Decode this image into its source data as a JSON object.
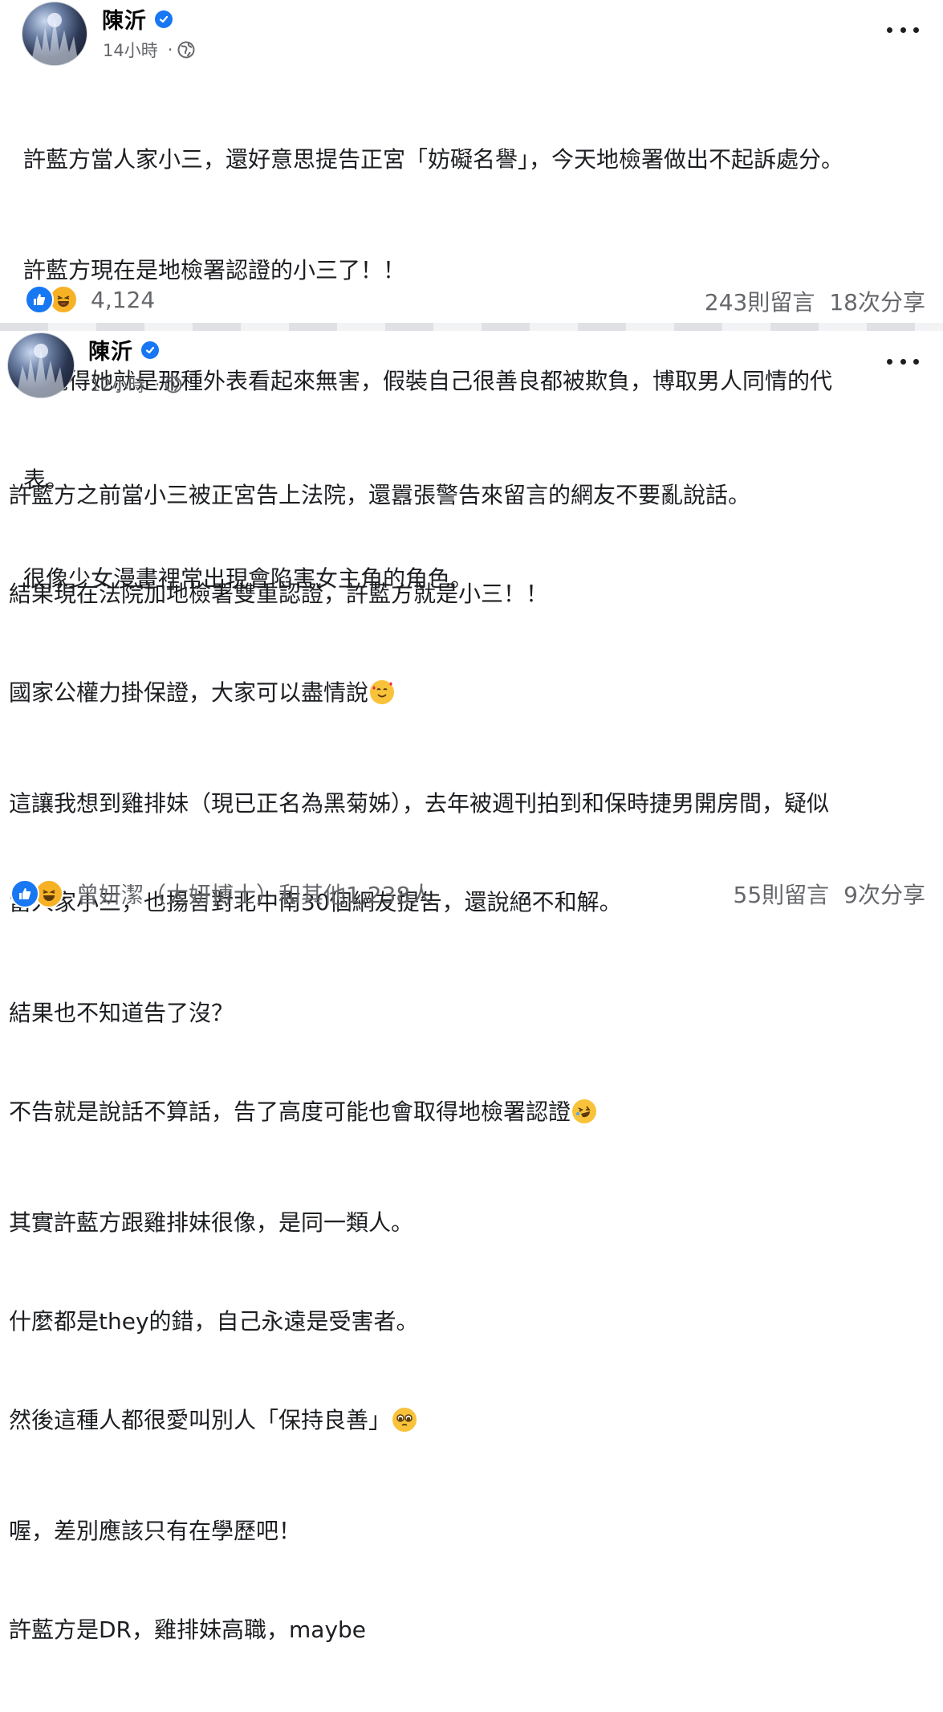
{
  "posts": [
    {
      "author": "陳沂",
      "time": "14小時",
      "separator": "·",
      "lines": [
        "許藍方當人家小三，還好意思提告正宮「妨礙名譽」，今天地檢署做出不起訴處分。",
        "許藍方現在是地檢署認證的小三了！！",
        "我覺得她就是那種外表看起來無害，假裝自己很善良都被欺負，博取男人同情的代",
        "表。",
        "很像少女漫畫裡常出現會陷害女主角的角色。"
      ],
      "reaction_count": "4,124",
      "comments": "243則留言",
      "shares": "18次分享"
    },
    {
      "author": "陳沂",
      "time": "12小時",
      "separator": "·",
      "lines": [
        "許藍方之前當小三被正宮告上法院，還囂張警告來留言的網友不要亂說話。",
        "結果現在法院加地檢署雙重認證，許藍方就是小三！！",
        "國家公權力掛保證，大家可以盡情說",
        "這讓我想到雞排妹（現已正名為黑菊姊），去年被週刊拍到和保時捷男開房間，疑似",
        "當人家小三，也揚言對北中南30個網友提告，還說絕不和解。",
        "結果也不知道告了沒？",
        "不告就是說話不算話，告了高度可能也會取得地檢署認證",
        "其實許藍方跟雞排妹很像，是同一類人。",
        "什麼都是they的錯，自己永遠是受害者。",
        "然後這種人都很愛叫別人「保持良善」",
        "喔，差別應該只有在學歷吧！",
        "許藍方是DR，雞排妹高職，maybe"
      ],
      "reaction_text": "曾妍潔（大妍博士）和其他1,238人",
      "comments": "55則留言",
      "shares": "9次分享"
    }
  ],
  "icons": {
    "verified": "verified-badge-icon",
    "privacy": "globe-icon",
    "more": "more-options-icon",
    "like": "like-reaction-icon",
    "haha": "haha-reaction-icon"
  },
  "colors": {
    "verified": "#1877f2",
    "like": "#1877f2",
    "haha": "#f7b125",
    "secondary_text": "#65676b"
  }
}
